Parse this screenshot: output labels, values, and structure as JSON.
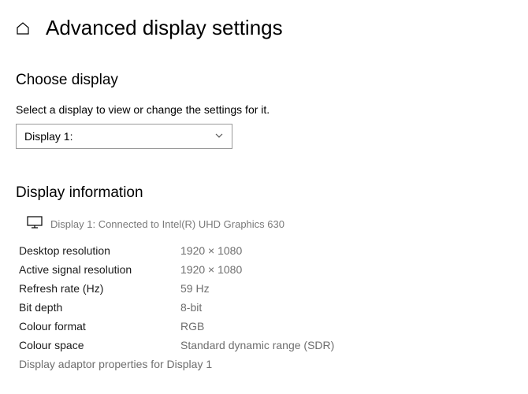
{
  "header": {
    "title": "Advanced display settings"
  },
  "choose": {
    "heading": "Choose display",
    "instruction": "Select a display to view or change the settings for it.",
    "dropdown_value": "Display 1:"
  },
  "info": {
    "heading": "Display information",
    "connected": "Display 1: Connected to Intel(R) UHD Graphics 630",
    "rows": [
      {
        "label": "Desktop resolution",
        "value": "1920 × 1080"
      },
      {
        "label": "Active signal resolution",
        "value": "1920 × 1080"
      },
      {
        "label": "Refresh rate (Hz)",
        "value": "59 Hz"
      },
      {
        "label": "Bit depth",
        "value": "8-bit"
      },
      {
        "label": "Colour format",
        "value": "RGB"
      },
      {
        "label": "Colour space",
        "value": "Standard dynamic range (SDR)"
      }
    ],
    "adaptor_link": "Display adaptor properties for Display 1"
  }
}
